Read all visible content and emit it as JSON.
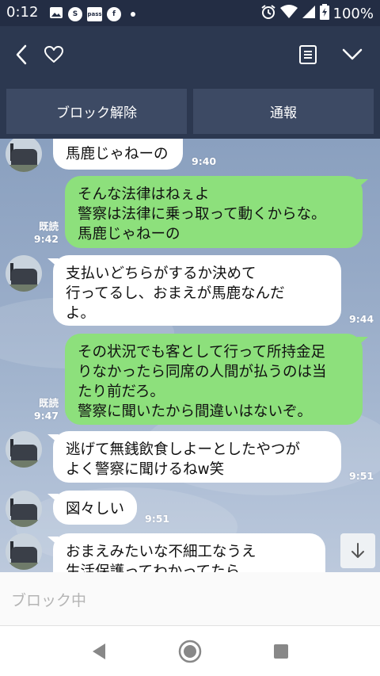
{
  "status_bar": {
    "time": "0:12",
    "notification_icons": [
      "image-icon",
      "skype-icon",
      "pass-icon",
      "facebook-icon",
      "dot-icon"
    ],
    "pass_label": "pass",
    "skype_letter": "S",
    "facebook_letter": "f",
    "battery": "100%"
  },
  "header": {
    "icons": [
      "back-icon",
      "heart-icon",
      "notes-icon",
      "chevron-down-icon"
    ]
  },
  "actions": {
    "unblock_label": "ブロック解除",
    "report_label": "通報"
  },
  "messages": [
    {
      "side": "in",
      "text": "馬鹿じゃねーの",
      "time": "9:40"
    },
    {
      "side": "out",
      "text": "そんな法律はねぇよ\n警察は法律に乗っ取って動くからな。\n馬鹿じゃねーの",
      "read": "既読",
      "time": "9:42"
    },
    {
      "side": "in",
      "text": "支払いどちらがするか決めて\n行ってるし、おまえが馬鹿なんだ\nよ。",
      "time": "9:44"
    },
    {
      "side": "out",
      "text": "その状況でも客として行って所持金足\nりなかったら同席の人間が払うのは当\nたり前だろ。\n警察に聞いたから間違いはないぞ。",
      "read": "既読",
      "time": "9:47"
    },
    {
      "side": "in",
      "text": "逃げて無銭飲食しよーとしたやつが\nよく警察に聞けるねw笑",
      "time": "9:51"
    },
    {
      "side": "in",
      "text": "図々しい",
      "time": "9:51"
    },
    {
      "side": "in",
      "text": "おまえみたいな不細工なうえ\n生活保護ってわかってたら",
      "time": ""
    }
  ],
  "footer": {
    "blocked_label": "ブロック中"
  },
  "colors": {
    "header_bg": "#2c3850",
    "status_bg": "#232d44",
    "outgoing_bubble": "#8de07c",
    "incoming_bubble": "#ffffff"
  }
}
